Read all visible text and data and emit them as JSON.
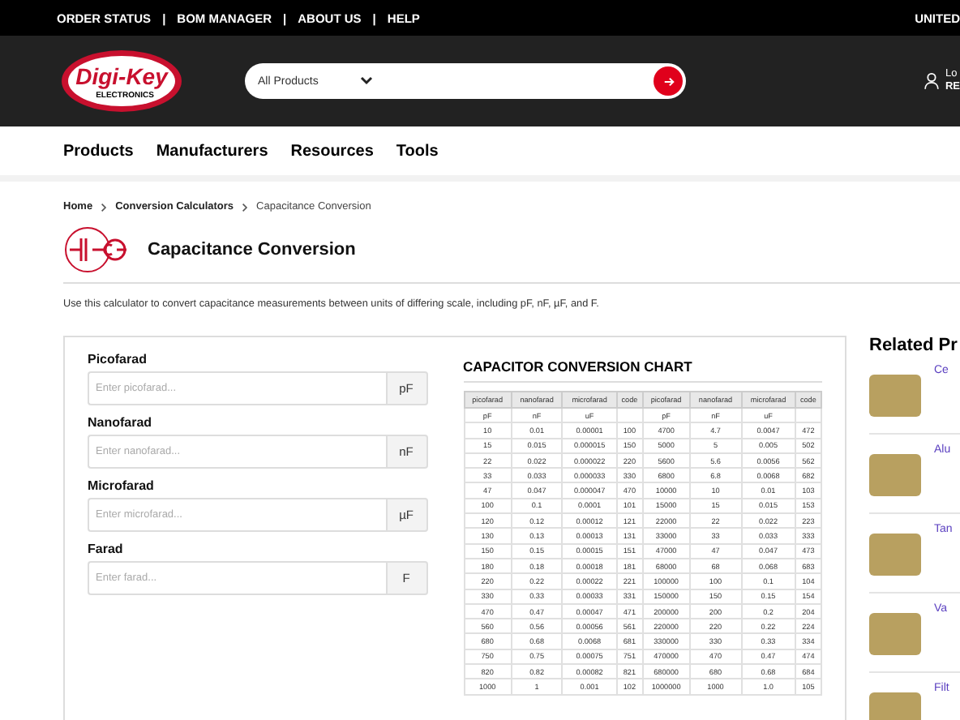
{
  "top_bar": {
    "links": [
      "ORDER STATUS",
      "BOM MANAGER",
      "ABOUT US",
      "HELP"
    ],
    "separator": "|",
    "region": "UNITED"
  },
  "header": {
    "logo": {
      "name": "Digi-Key",
      "sub": "ELECTRONICS"
    },
    "search": {
      "category": "All Products"
    },
    "account": {
      "line_1": "Lo",
      "line_2": "RE"
    }
  },
  "nav": [
    "Products",
    "Manufacturers",
    "Resources",
    "Tools"
  ],
  "breadcrumb": [
    {
      "label": "Home",
      "current": false
    },
    {
      "label": "Conversion Calculators",
      "current": false
    },
    {
      "label": "Capacitance Conversion",
      "current": true
    }
  ],
  "page_title": "Capacitance Conversion",
  "description": "Use this calculator to convert capacitance measurements between units of differing scale, including pF, nF, µF, and F.",
  "fields": [
    {
      "label": "Picofarad",
      "placeholder": "Enter picofarad...",
      "unit": "pF"
    },
    {
      "label": "Nanofarad",
      "placeholder": "Enter nanofarad...",
      "unit": "nF"
    },
    {
      "label": "Microfarad",
      "placeholder": "Enter microfarad...",
      "unit": "µF"
    },
    {
      "label": "Farad",
      "placeholder": "Enter farad...",
      "unit": "F"
    }
  ],
  "chart": {
    "title": "CAPACITOR CONVERSION CHART",
    "columns": [
      {
        "name": "picofarad",
        "unit": "pF"
      },
      {
        "name": "nanofarad",
        "unit": "nF"
      },
      {
        "name": "microfarad",
        "unit": "uF"
      },
      {
        "name": "code"
      },
      {
        "name": "picofarad",
        "unit": "pF"
      },
      {
        "name": "nanofarad",
        "unit": "nF"
      },
      {
        "name": "microfarad",
        "unit": "uF"
      },
      {
        "name": "code"
      }
    ],
    "rows": [
      [
        "10",
        "0.01",
        "0.00001",
        "100",
        "4700",
        "4.7",
        "0.0047",
        "472"
      ],
      [
        "15",
        "0.015",
        "0.000015",
        "150",
        "5000",
        "5",
        "0.005",
        "502"
      ],
      [
        "22",
        "0.022",
        "0.000022",
        "220",
        "5600",
        "5.6",
        "0.0056",
        "562"
      ],
      [
        "33",
        "0.033",
        "0.000033",
        "330",
        "6800",
        "6.8",
        "0.0068",
        "682"
      ],
      [
        "47",
        "0.047",
        "0.000047",
        "470",
        "10000",
        "10",
        "0.01",
        "103"
      ],
      [
        "100",
        "0.1",
        "0.0001",
        "101",
        "15000",
        "15",
        "0.015",
        "153"
      ],
      [
        "120",
        "0.12",
        "0.00012",
        "121",
        "22000",
        "22",
        "0.022",
        "223"
      ],
      [
        "130",
        "0.13",
        "0.00013",
        "131",
        "33000",
        "33",
        "0.033",
        "333"
      ],
      [
        "150",
        "0.15",
        "0.00015",
        "151",
        "47000",
        "47",
        "0.047",
        "473"
      ],
      [
        "180",
        "0.18",
        "0.00018",
        "181",
        "68000",
        "68",
        "0.068",
        "683"
      ],
      [
        "220",
        "0.22",
        "0.00022",
        "221",
        "100000",
        "100",
        "0.1",
        "104"
      ],
      [
        "330",
        "0.33",
        "0.00033",
        "331",
        "150000",
        "150",
        "0.15",
        "154"
      ],
      [
        "470",
        "0.47",
        "0.00047",
        "471",
        "200000",
        "200",
        "0.2",
        "204"
      ],
      [
        "560",
        "0.56",
        "0.00056",
        "561",
        "220000",
        "220",
        "0.22",
        "224"
      ],
      [
        "680",
        "0.68",
        "0.0068",
        "681",
        "330000",
        "330",
        "0.33",
        "334"
      ],
      [
        "750",
        "0.75",
        "0.00075",
        "751",
        "470000",
        "470",
        "0.47",
        "474"
      ],
      [
        "820",
        "0.82",
        "0.00082",
        "821",
        "680000",
        "680",
        "0.68",
        "684"
      ],
      [
        "1000",
        "1",
        "0.001",
        "102",
        "1000000",
        "1000",
        "1.0",
        "105"
      ]
    ]
  },
  "related": {
    "title": "Related Pr",
    "items": [
      "Ce",
      "Alu",
      "Tan",
      "Va",
      "Filt"
    ]
  }
}
